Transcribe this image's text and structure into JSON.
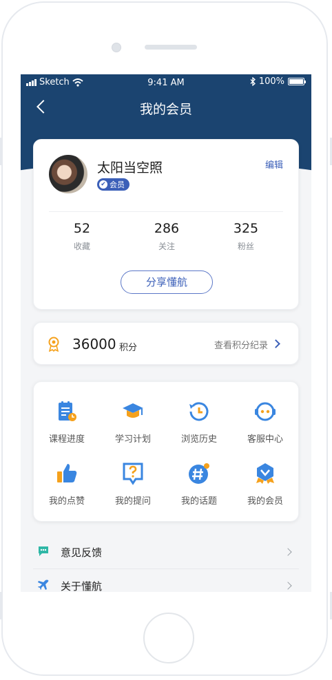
{
  "status_bar": {
    "carrier": "Sketch",
    "time": "9:41 AM",
    "battery": "100%"
  },
  "nav": {
    "title": "我的会员"
  },
  "profile": {
    "name": "太阳当空照",
    "badge": "会员",
    "edit": "编辑",
    "stats": [
      {
        "value": "52",
        "label": "收藏"
      },
      {
        "value": "286",
        "label": "关注"
      },
      {
        "value": "325",
        "label": "粉丝"
      }
    ],
    "share_button": "分享懂航"
  },
  "points": {
    "value": "36000",
    "unit": "积分",
    "link": "查看积分纪录"
  },
  "menu": [
    {
      "label": "课程进度",
      "icon": "course-progress-icon"
    },
    {
      "label": "学习计划",
      "icon": "study-plan-icon"
    },
    {
      "label": "浏览历史",
      "icon": "history-icon"
    },
    {
      "label": "客服中心",
      "icon": "customer-service-icon"
    },
    {
      "label": "我的点赞",
      "icon": "thumbs-up-icon"
    },
    {
      "label": "我的提问",
      "icon": "question-icon"
    },
    {
      "label": "我的话题",
      "icon": "topic-icon"
    },
    {
      "label": "我的会员",
      "icon": "member-icon"
    }
  ],
  "list": [
    {
      "label": "意见反馈",
      "icon": "feedback-icon"
    },
    {
      "label": "关于懂航",
      "icon": "airplane-icon"
    }
  ],
  "colors": {
    "header": "#1b4470",
    "accent": "#3b5fb8",
    "icon_blue": "#3a86e0",
    "icon_orange": "#f5a11c"
  }
}
